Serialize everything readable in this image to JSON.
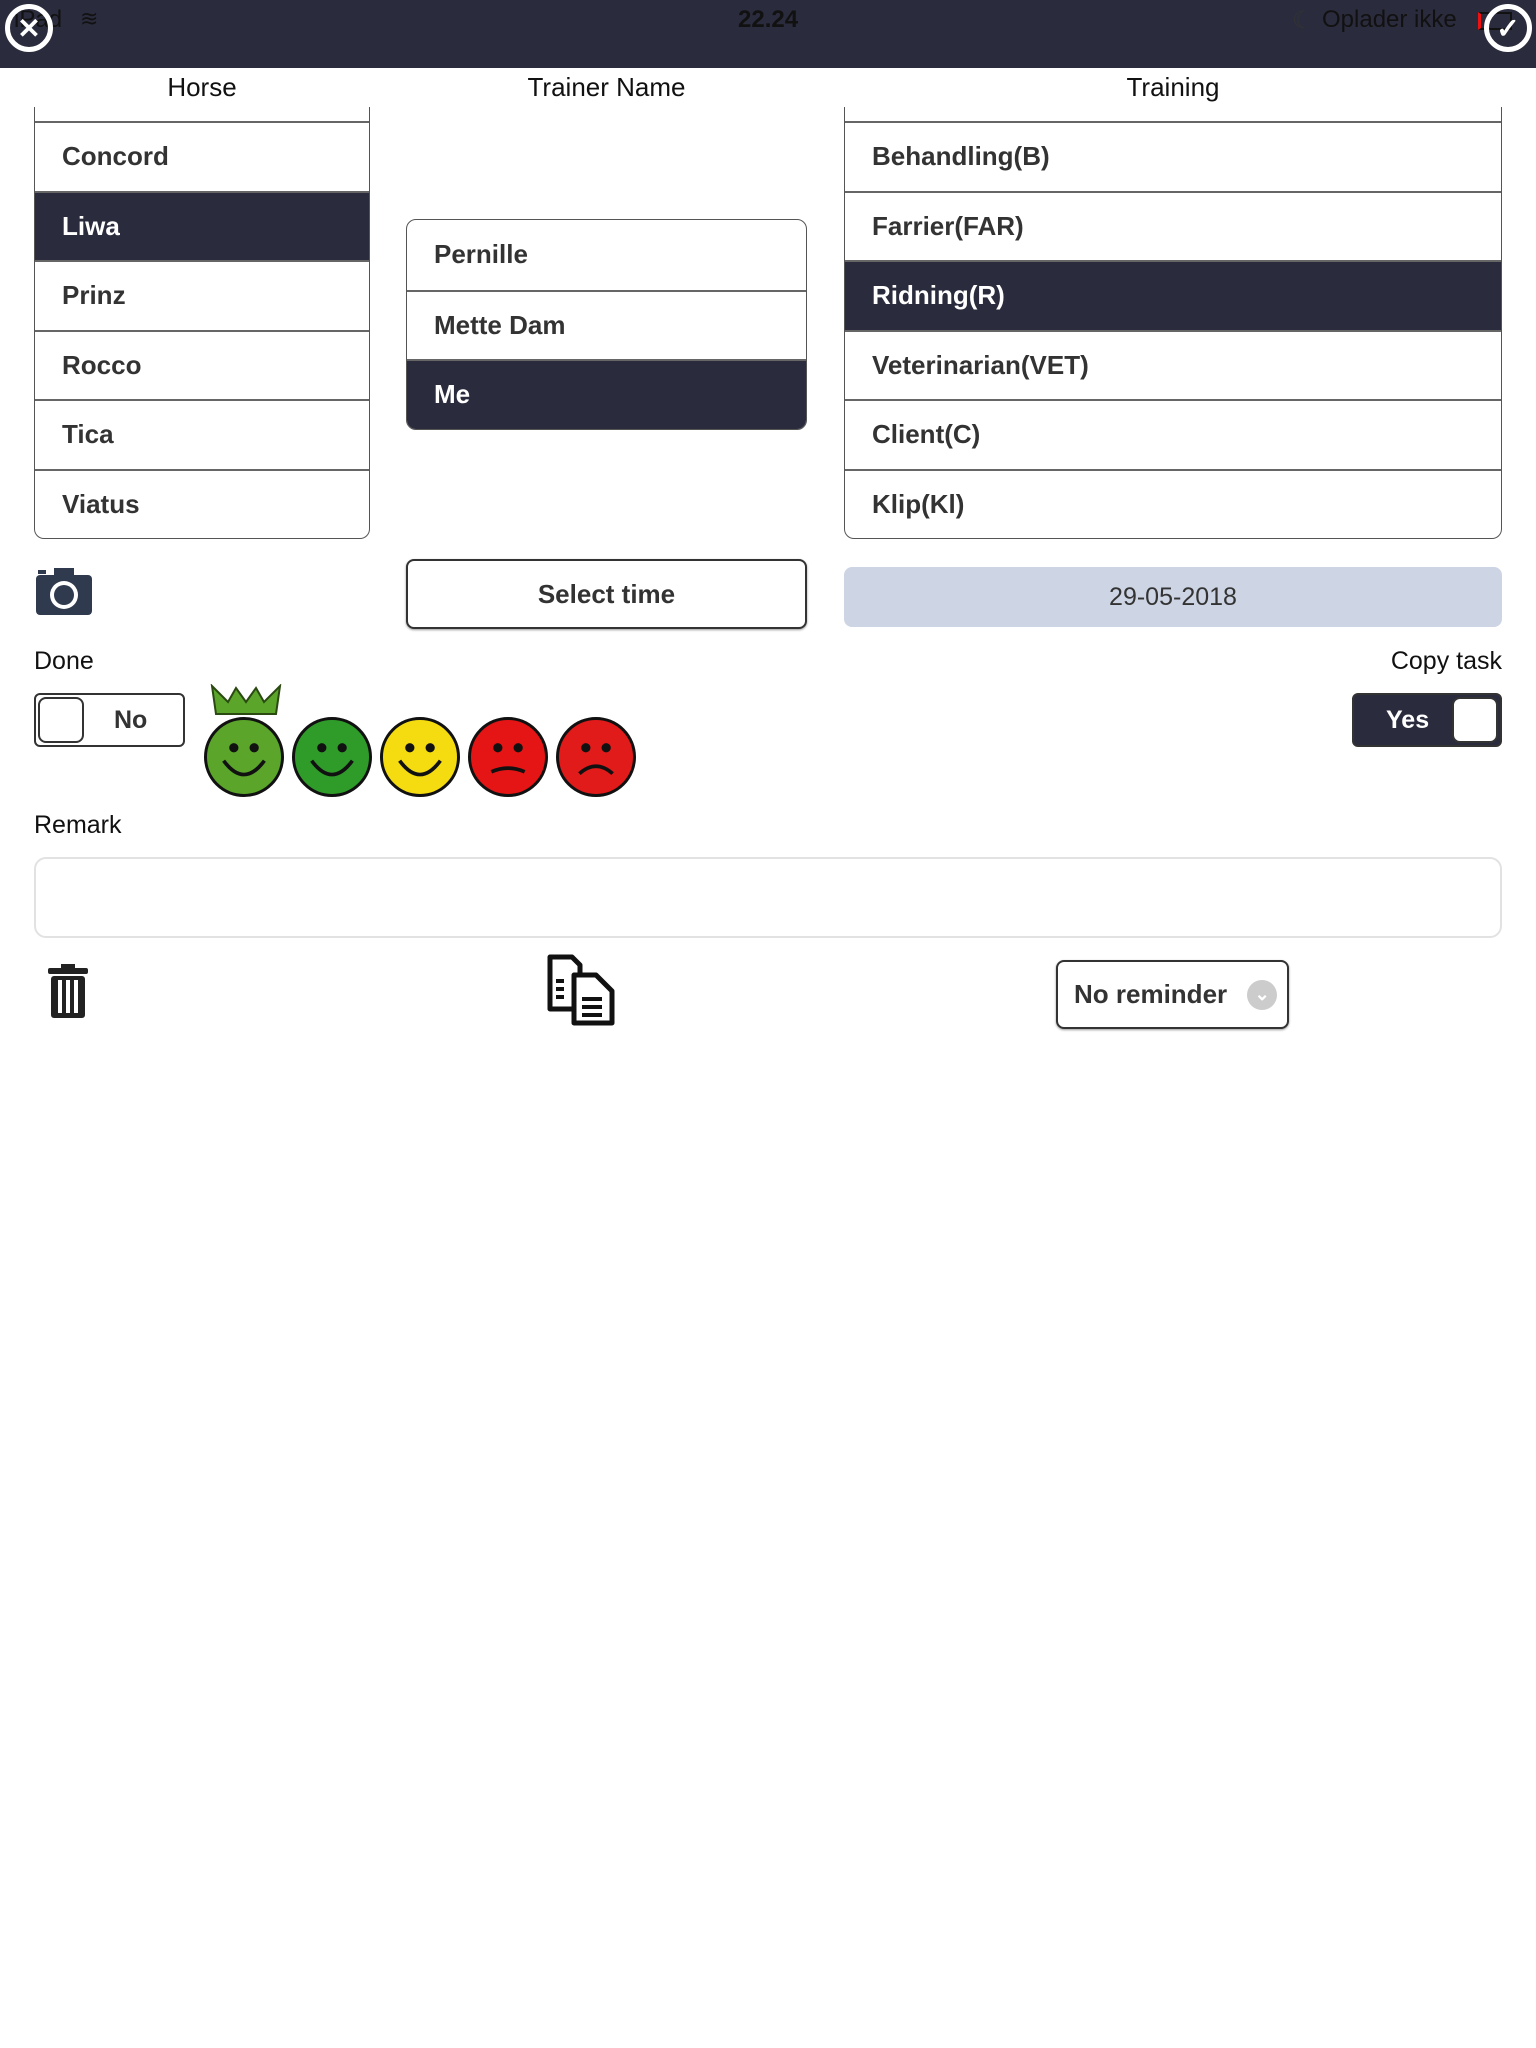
{
  "status_bar": {
    "device": "iPad",
    "time": "22.24",
    "battery_text": "Oplader ikke"
  },
  "headers": {
    "horse": "Horse",
    "trainer": "Trainer Name",
    "training": "Training"
  },
  "horses": [
    {
      "label": "Concord"
    },
    {
      "label": "Liwa",
      "selected": true
    },
    {
      "label": "Prinz"
    },
    {
      "label": "Rocco"
    },
    {
      "label": "Tica"
    },
    {
      "label": "Viatus"
    }
  ],
  "trainers": [
    {
      "label": "Pernille"
    },
    {
      "label": "Mette Dam"
    },
    {
      "label": "Me",
      "selected": true
    }
  ],
  "trainings": [
    {
      "label": "Behandling(B)"
    },
    {
      "label": "Farrier(FAR)"
    },
    {
      "label": "Ridning(R)",
      "selected": true
    },
    {
      "label": "Veterinarian(VET)"
    },
    {
      "label": "Client(C)"
    },
    {
      "label": "Klip(Kl)"
    }
  ],
  "select_time_label": "Select time",
  "date": "29-05-2018",
  "done": {
    "label": "Done",
    "value": "No",
    "on": false
  },
  "copy_task": {
    "label": "Copy task",
    "value": "Yes",
    "on": true
  },
  "rating": {
    "options": [
      "very-happy-crowned",
      "happy",
      "neutral",
      "sad",
      "very-sad"
    ],
    "colors": [
      "#5aa52a",
      "#2f9c2a",
      "#f5dc10",
      "#e51515",
      "#e11a1a"
    ]
  },
  "remark": {
    "label": "Remark",
    "value": ""
  },
  "reminder": {
    "selected": "No reminder"
  },
  "colors": {
    "primary": "#2a2b3d",
    "date_bg": "#cdd5e4"
  }
}
